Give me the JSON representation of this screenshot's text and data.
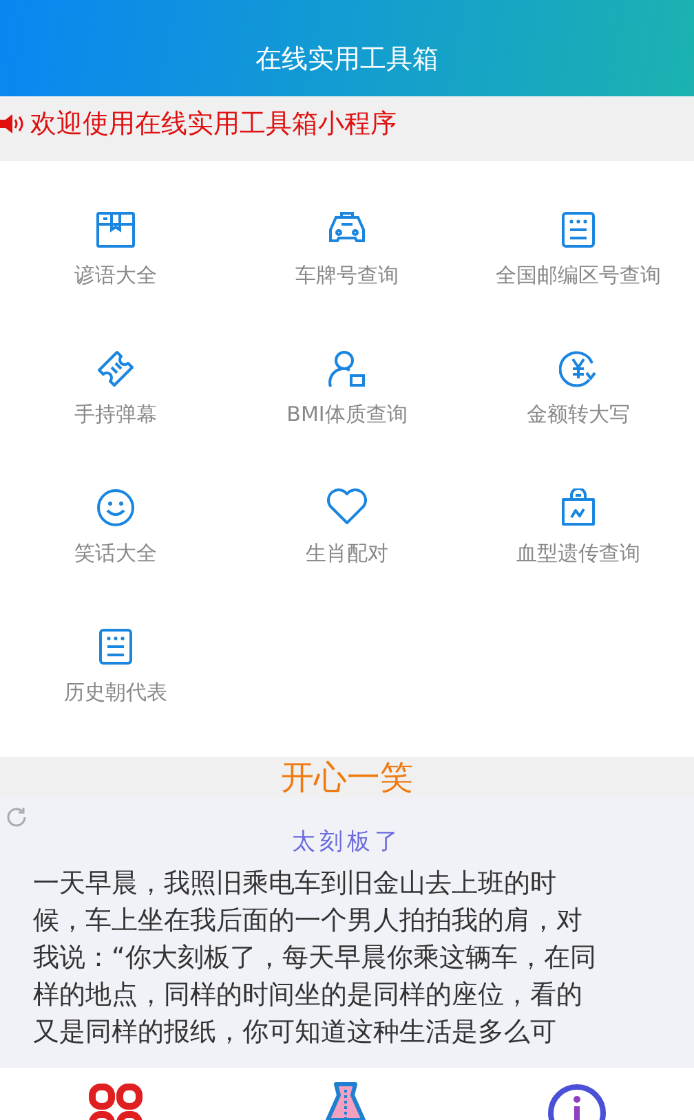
{
  "header": {
    "title": "在线实用工具箱"
  },
  "notice": {
    "text": "欢迎使用在线实用工具箱小程序"
  },
  "tools": [
    {
      "label": "谚语大全"
    },
    {
      "label": "车牌号查询"
    },
    {
      "label": "全国邮编区号查询"
    },
    {
      "label": "手持弹幕"
    },
    {
      "label": "BMI体质查询"
    },
    {
      "label": "金额转大写"
    },
    {
      "label": "笑话大全"
    },
    {
      "label": "生肖配对"
    },
    {
      "label": "血型遗传查询"
    },
    {
      "label": "历史朝代表"
    }
  ],
  "joke_section": {
    "heading": "开心一笑",
    "title": "太刻板了",
    "body": "一天早晨，我照旧乘电车到旧金山去上班的时候，车上坐在我后面的一个男人拍拍我的肩，对我说：“你大刻板了，每天早晨你乘这辆车，在同样的地点，同样的时间坐的是同样的座位，看的又是同样的报纸，你可知道这种生活是多么可"
  }
}
